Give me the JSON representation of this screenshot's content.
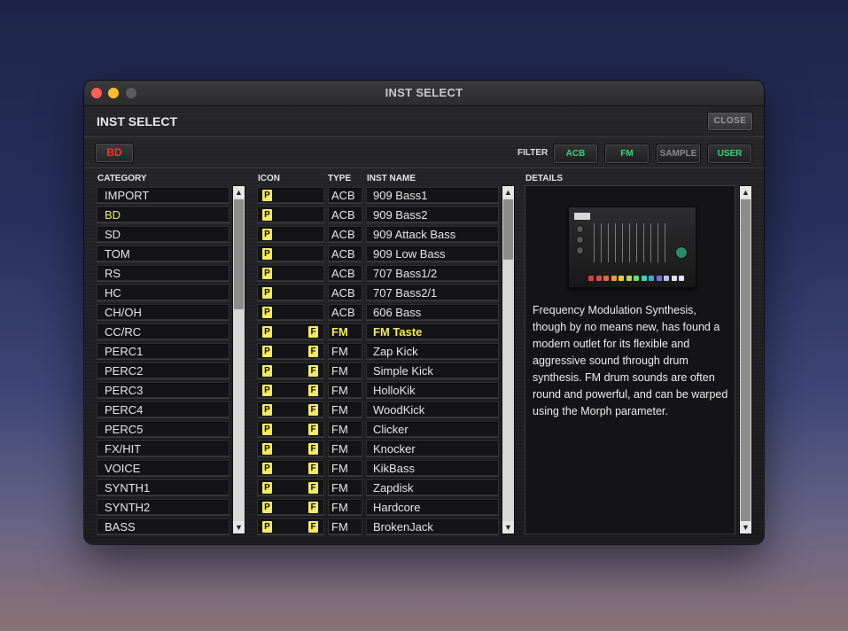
{
  "window": {
    "title": "INST SELECT"
  },
  "header": {
    "title": "INST SELECT",
    "close_label": "CLOSE"
  },
  "toolbar": {
    "part_button": "BD",
    "filter_label": "FILTER",
    "filters": [
      {
        "label": "ACB",
        "active": true,
        "color": "#3fd07a"
      },
      {
        "label": "FM",
        "active": true,
        "color": "#3fd07a"
      },
      {
        "label": "SAMPLE",
        "active": false,
        "color": "#8a8a8a"
      },
      {
        "label": "USER",
        "active": true,
        "color": "#3fd07a"
      }
    ]
  },
  "columns": {
    "category": "CATEGORY",
    "icon": "ICON",
    "type": "TYPE",
    "inst_name": "INST NAME",
    "details": "DETAILS"
  },
  "categories": [
    {
      "label": "IMPORT"
    },
    {
      "label": "BD",
      "selected": true
    },
    {
      "label": "SD"
    },
    {
      "label": "TOM"
    },
    {
      "label": "RS"
    },
    {
      "label": "HC"
    },
    {
      "label": "CH/OH"
    },
    {
      "label": "CC/RC"
    },
    {
      "label": "PERC1"
    },
    {
      "label": "PERC2"
    },
    {
      "label": "PERC3"
    },
    {
      "label": "PERC4"
    },
    {
      "label": "PERC5"
    },
    {
      "label": "FX/HIT"
    },
    {
      "label": "VOICE"
    },
    {
      "label": "SYNTH1"
    },
    {
      "label": "SYNTH2"
    },
    {
      "label": "BASS"
    }
  ],
  "instruments": [
    {
      "p": "P",
      "f": "",
      "type": "ACB",
      "name": "909 Bass1"
    },
    {
      "p": "P",
      "f": "",
      "type": "ACB",
      "name": "909 Bass2"
    },
    {
      "p": "P",
      "f": "",
      "type": "ACB",
      "name": "909 Attack Bass"
    },
    {
      "p": "P",
      "f": "",
      "type": "ACB",
      "name": "909 Low Bass"
    },
    {
      "p": "P",
      "f": "",
      "type": "ACB",
      "name": "707 Bass1/2"
    },
    {
      "p": "P",
      "f": "",
      "type": "ACB",
      "name": "707 Bass2/1"
    },
    {
      "p": "P",
      "f": "",
      "type": "ACB",
      "name": "606 Bass"
    },
    {
      "p": "P",
      "f": "F",
      "type": "FM",
      "name": "FM Taste",
      "selected": true
    },
    {
      "p": "P",
      "f": "F",
      "type": "FM",
      "name": "Zap Kick"
    },
    {
      "p": "P",
      "f": "F",
      "type": "FM",
      "name": "Simple Kick"
    },
    {
      "p": "P",
      "f": "F",
      "type": "FM",
      "name": "HolloKik"
    },
    {
      "p": "P",
      "f": "F",
      "type": "FM",
      "name": "WoodKick"
    },
    {
      "p": "P",
      "f": "F",
      "type": "FM",
      "name": "Clicker"
    },
    {
      "p": "P",
      "f": "F",
      "type": "FM",
      "name": "Knocker"
    },
    {
      "p": "P",
      "f": "F",
      "type": "FM",
      "name": "KikBass"
    },
    {
      "p": "P",
      "f": "F",
      "type": "FM",
      "name": "Zapdisk"
    },
    {
      "p": "P",
      "f": "F",
      "type": "FM",
      "name": "Hardcore"
    },
    {
      "p": "P",
      "f": "F",
      "type": "FM",
      "name": "BrokenJack"
    }
  ],
  "details": {
    "image_icon": "drum-machine-image",
    "text": "Frequency Modulation Synthesis, though by no means new, has found a modern outlet for its flexible and aggressive sound through drum synthesis. FM drum sounds are often round and powerful, and can be warped using the Morph parameter."
  },
  "icons": {
    "scroll_up": "▲",
    "scroll_down": "▼"
  },
  "colors": {
    "selected_text": "#f0e968",
    "badge": "#f4ea6a",
    "part_button_text": "#ff3030",
    "filter_active": "#3fd07a"
  }
}
